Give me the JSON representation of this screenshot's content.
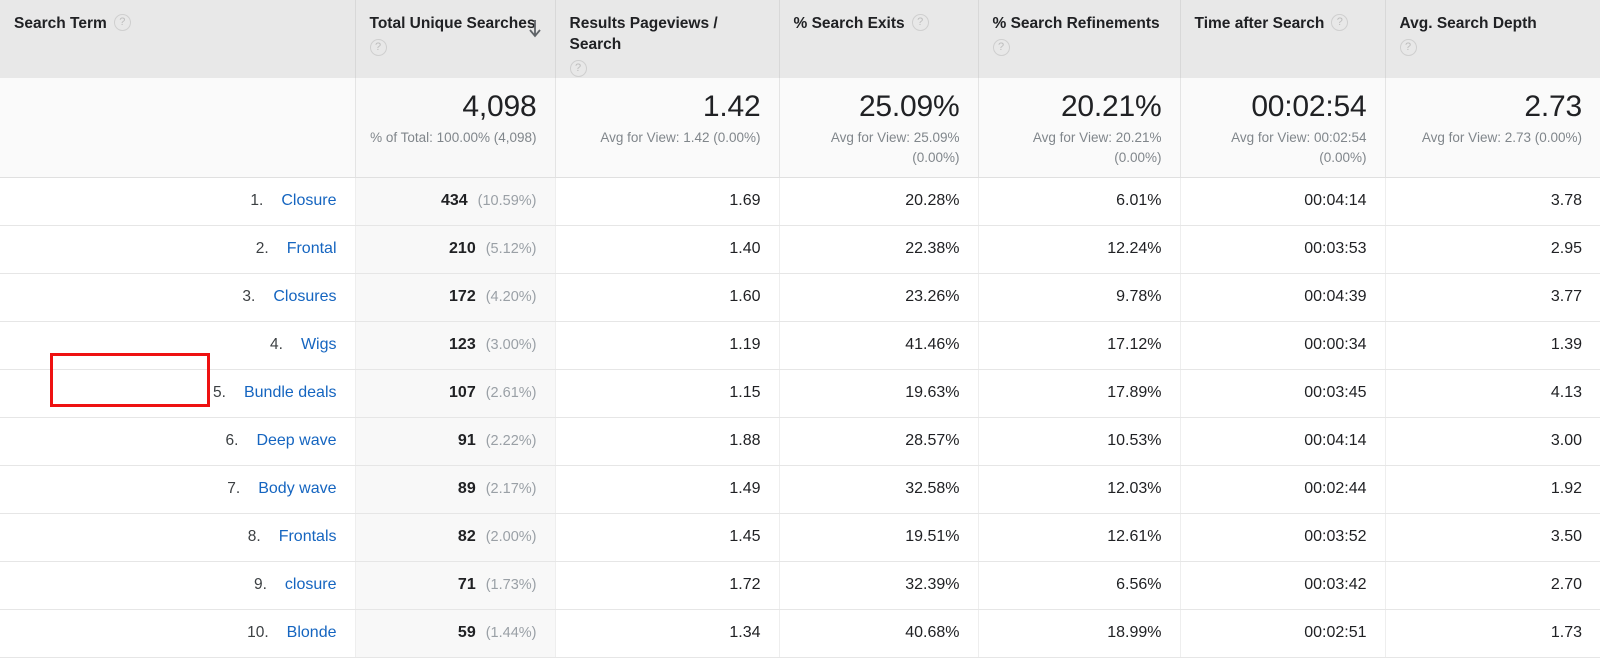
{
  "table": {
    "columns": [
      {
        "label": "Search Term",
        "help_icon": "help-icon",
        "align": "left",
        "help_inline": true
      },
      {
        "label": "Total Unique Searches",
        "help_icon": "help-icon",
        "align": "right",
        "help_inline": false,
        "sorted": true,
        "sort_icon": "arrow-down-icon"
      },
      {
        "label": "Results Pageviews / Search",
        "help_icon": "help-icon",
        "align": "right",
        "help_inline": false
      },
      {
        "label": "% Search Exits",
        "help_icon": "help-icon",
        "align": "right",
        "help_inline": true
      },
      {
        "label": "% Search Refinements",
        "help_icon": "help-icon",
        "align": "right",
        "help_inline": false
      },
      {
        "label": "Time after Search",
        "help_icon": "help-icon",
        "align": "right",
        "help_inline": true
      },
      {
        "label": "Avg. Search Depth",
        "help_icon": "help-icon",
        "align": "right",
        "help_inline": false
      }
    ],
    "summary": [
      {
        "value": "",
        "sub": ""
      },
      {
        "value": "4,098",
        "sub": "% of Total: 100.00% (4,098)"
      },
      {
        "value": "1.42",
        "sub": "Avg for View: 1.42 (0.00%)"
      },
      {
        "value": "25.09%",
        "sub": "Avg for View: 25.09% (0.00%)"
      },
      {
        "value": "20.21%",
        "sub": "Avg for View: 20.21% (0.00%)"
      },
      {
        "value": "00:02:54",
        "sub": "Avg for View: 00:02:54 (0.00%)"
      },
      {
        "value": "2.73",
        "sub": "Avg for View: 2.73 (0.00%)"
      }
    ],
    "rows": [
      {
        "index": "1.",
        "term": "Closure",
        "unique_searches": "434",
        "share": "(10.59%)",
        "pageviews_per_search": "1.69",
        "search_exits": "20.28%",
        "search_refinements": "6.01%",
        "time_after_search": "00:04:14",
        "avg_search_depth": "3.78",
        "highlighted": false
      },
      {
        "index": "2.",
        "term": "Frontal",
        "unique_searches": "210",
        "share": "(5.12%)",
        "pageviews_per_search": "1.40",
        "search_exits": "22.38%",
        "search_refinements": "12.24%",
        "time_after_search": "00:03:53",
        "avg_search_depth": "2.95",
        "highlighted": false
      },
      {
        "index": "3.",
        "term": "Closures",
        "unique_searches": "172",
        "share": "(4.20%)",
        "pageviews_per_search": "1.60",
        "search_exits": "23.26%",
        "search_refinements": "9.78%",
        "time_after_search": "00:04:39",
        "avg_search_depth": "3.77",
        "highlighted": false
      },
      {
        "index": "4.",
        "term": "Wigs",
        "unique_searches": "123",
        "share": "(3.00%)",
        "pageviews_per_search": "1.19",
        "search_exits": "41.46%",
        "search_refinements": "17.12%",
        "time_after_search": "00:00:34",
        "avg_search_depth": "1.39",
        "highlighted": false
      },
      {
        "index": "5.",
        "term": "Bundle deals",
        "unique_searches": "107",
        "share": "(2.61%)",
        "pageviews_per_search": "1.15",
        "search_exits": "19.63%",
        "search_refinements": "17.89%",
        "time_after_search": "00:03:45",
        "avg_search_depth": "4.13",
        "highlighted": true
      },
      {
        "index": "6.",
        "term": "Deep wave",
        "unique_searches": "91",
        "share": "(2.22%)",
        "pageviews_per_search": "1.88",
        "search_exits": "28.57%",
        "search_refinements": "10.53%",
        "time_after_search": "00:04:14",
        "avg_search_depth": "3.00",
        "highlighted": false
      },
      {
        "index": "7.",
        "term": "Body wave",
        "unique_searches": "89",
        "share": "(2.17%)",
        "pageviews_per_search": "1.49",
        "search_exits": "32.58%",
        "search_refinements": "12.03%",
        "time_after_search": "00:02:44",
        "avg_search_depth": "1.92",
        "highlighted": false
      },
      {
        "index": "8.",
        "term": "Frontals",
        "unique_searches": "82",
        "share": "(2.00%)",
        "pageviews_per_search": "1.45",
        "search_exits": "19.51%",
        "search_refinements": "12.61%",
        "time_after_search": "00:03:52",
        "avg_search_depth": "3.50",
        "highlighted": false
      },
      {
        "index": "9.",
        "term": "closure",
        "unique_searches": "71",
        "share": "(1.73%)",
        "pageviews_per_search": "1.72",
        "search_exits": "32.39%",
        "search_refinements": "6.56%",
        "time_after_search": "00:03:42",
        "avg_search_depth": "2.70",
        "highlighted": false
      },
      {
        "index": "10.",
        "term": "Blonde",
        "unique_searches": "59",
        "share": "(1.44%)",
        "pageviews_per_search": "1.34",
        "search_exits": "40.68%",
        "search_refinements": "18.99%",
        "time_after_search": "00:02:51",
        "avg_search_depth": "1.73",
        "highlighted": false
      }
    ]
  },
  "annotation": {
    "highlight_color": "#ee1111",
    "target_term": "Bundle deals"
  },
  "colors": {
    "link": "#1565c0",
    "header_bg": "#e8e8e8",
    "summary_bg": "#fafafa",
    "sorted_col_bg": "#f8f8f8",
    "muted_text": "#9aa0a6"
  }
}
